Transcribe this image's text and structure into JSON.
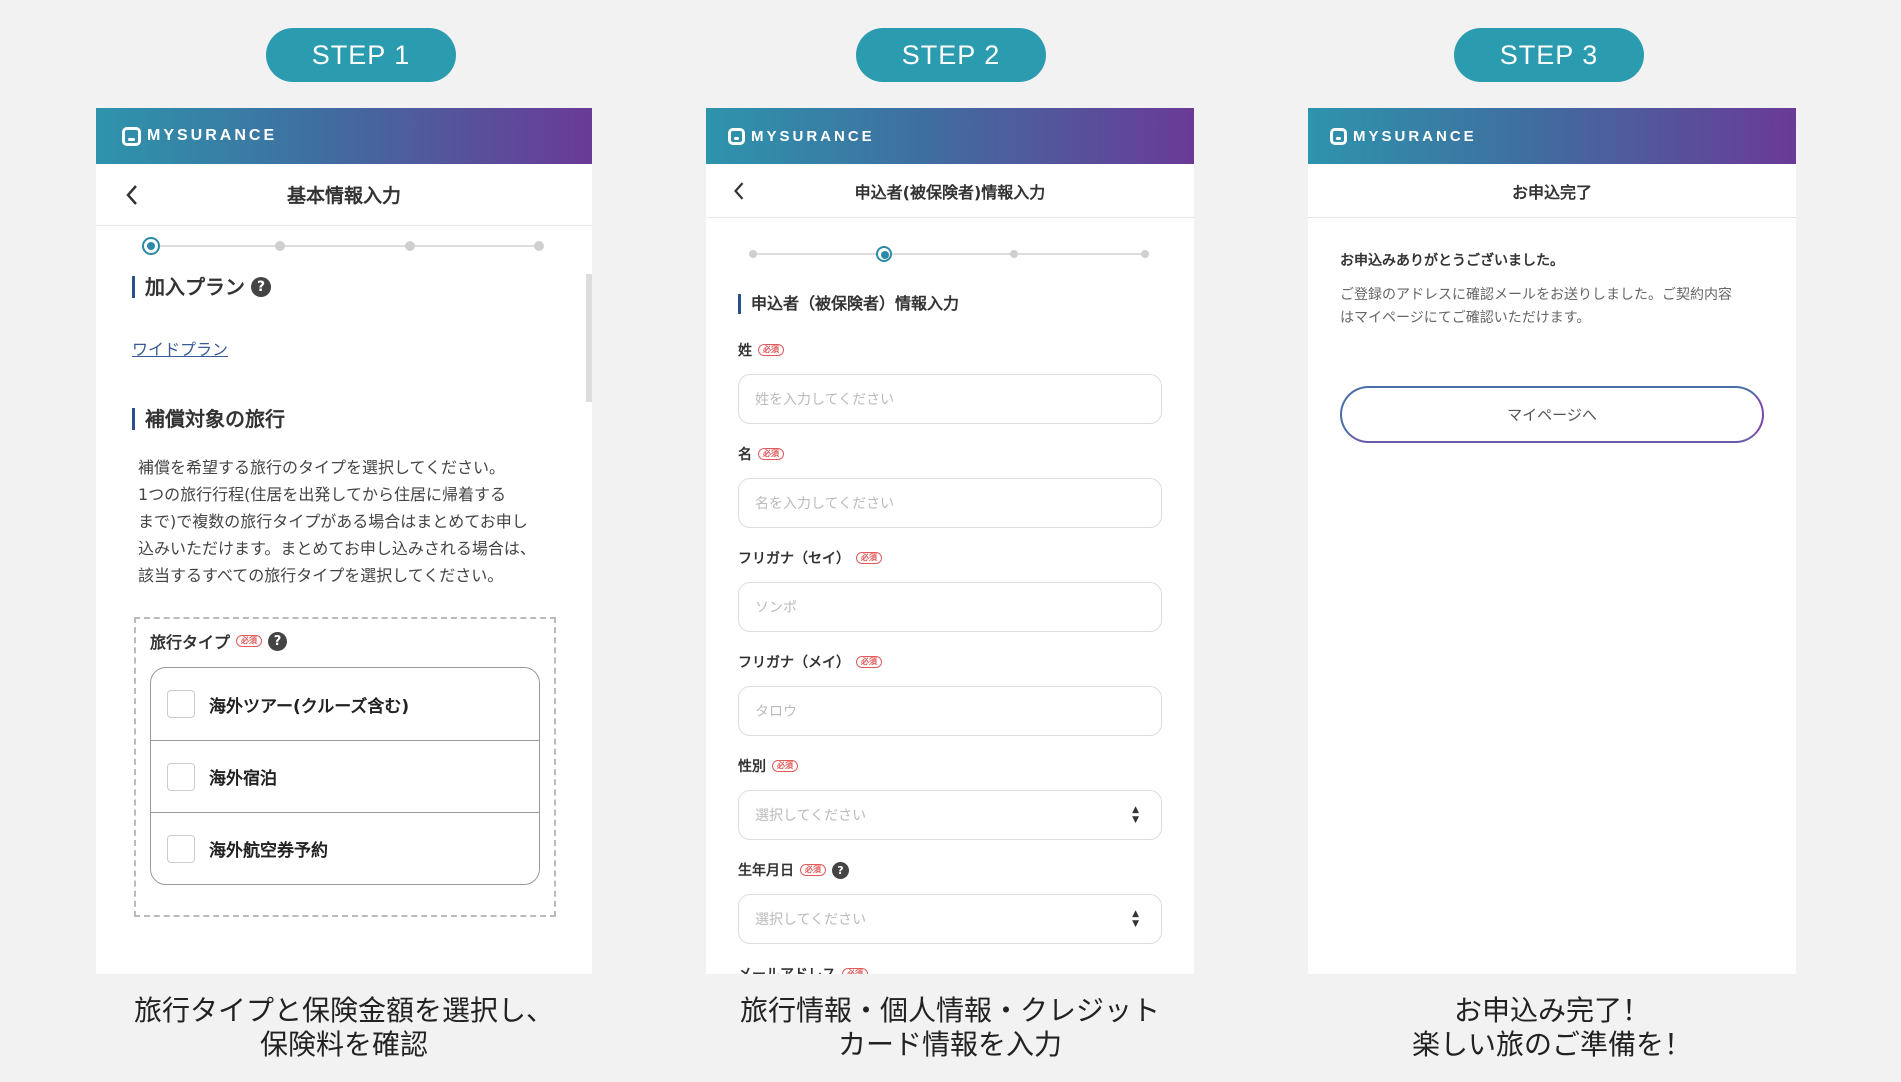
{
  "steps": [
    {
      "pill": "STEP 1",
      "caption_line1": "旅行タイプと保険金額を選択し、",
      "caption_line2": "保険料を確認"
    },
    {
      "pill": "STEP 2",
      "caption_line1": "旅行情報・個人情報・クレジット",
      "caption_line2": "カード情報を入力"
    },
    {
      "pill": "STEP 3",
      "caption_line1": "お申込み完了！",
      "caption_line2": "楽しい旅のご準備を！"
    }
  ],
  "brand": {
    "name": "MYSURANCE"
  },
  "screen1": {
    "title": "基本情報入力",
    "plan_heading": "加入プラン",
    "plan_link": "ワイドプラン",
    "target_heading": "補償対象の旅行",
    "desc_lines": [
      "補償を希望する旅行のタイプを選択してください。",
      "1つの旅行行程(住居を出発してから住居に帰着する",
      "まで)で複数の旅行タイプがある場合はまとめてお申し",
      "込みいただけます。まとめてお申し込みされる場合は、",
      "該当するすべての旅行タイプを選択してください。"
    ],
    "travel_type_label": "旅行タイプ",
    "required_badge": "必須",
    "options": [
      "海外ツアー(クルーズ含む)",
      "海外宿泊",
      "海外航空券予約"
    ]
  },
  "screen2": {
    "title": "申込者(被保険者)情報入力",
    "section_heading": "申込者（被保険者）情報入力",
    "required_badge": "必須",
    "fields": [
      {
        "label": "姓",
        "placeholder": "姓を入力してください"
      },
      {
        "label": "名",
        "placeholder": "名を入力してください"
      },
      {
        "label": "フリガナ（セイ）",
        "placeholder": "ソンポ"
      },
      {
        "label": "フリガナ（メイ）",
        "placeholder": "タロウ"
      },
      {
        "label": "性別",
        "placeholder": "選択してください"
      },
      {
        "label": "生年月日",
        "placeholder": "選択してください"
      }
    ],
    "partial_label": "メールアドレス"
  },
  "screen3": {
    "title": "お申込完了",
    "thanks": "お申込みありがとうございました。",
    "info_line1": "ご登録のアドレスに確認メールをお送りしました。ご契約内容",
    "info_line2": "はマイページにてご確認いただけます。",
    "button": "マイページへ"
  },
  "colors": {
    "pill": "#2b9bb0",
    "header_start": "#2e94ac",
    "header_end": "#6a3a97",
    "stepper_active": "#2b8aa5",
    "required_red": "#e25a5a"
  },
  "stepper": {
    "screen1_active_step": 1,
    "screen2_active_step": 2,
    "total_steps": 4
  }
}
